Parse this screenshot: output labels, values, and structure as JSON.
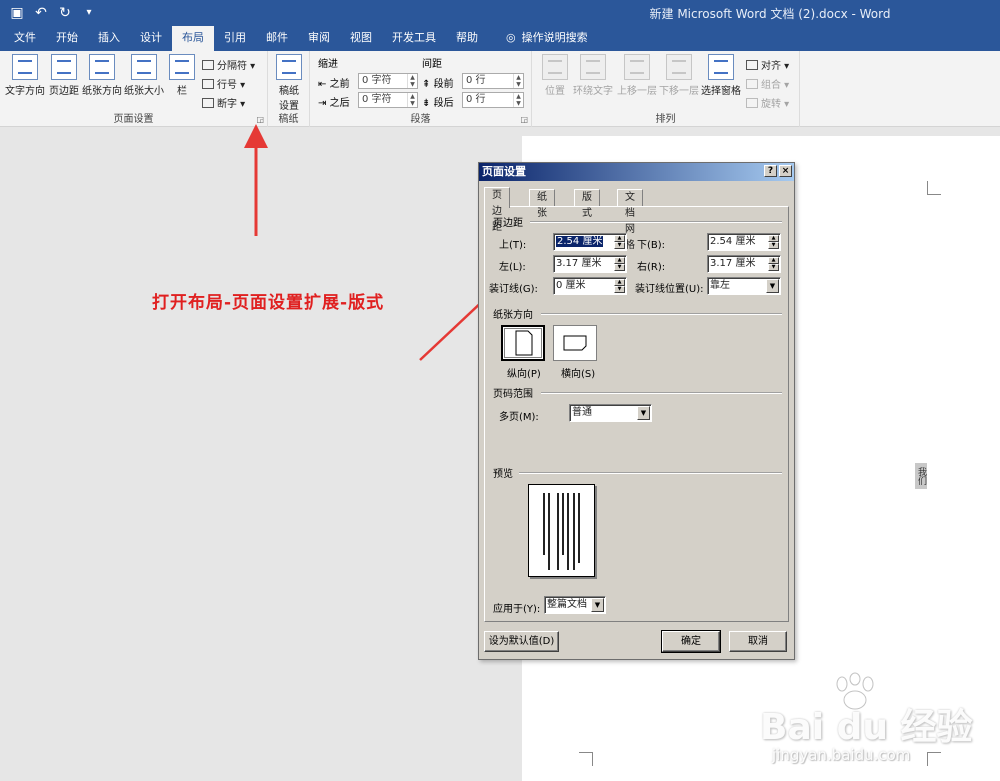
{
  "window": {
    "title": "新建 Microsoft Word 文档 (2).docx - Word"
  },
  "qat": {
    "save_icon": "save-icon",
    "undo_icon": "undo-icon",
    "redo_icon": "redo-icon",
    "customize_icon": "customize-icon"
  },
  "tabs": [
    {
      "label": "文件"
    },
    {
      "label": "开始"
    },
    {
      "label": "插入"
    },
    {
      "label": "设计"
    },
    {
      "label": "布局",
      "active": true
    },
    {
      "label": "引用"
    },
    {
      "label": "邮件"
    },
    {
      "label": "审阅"
    },
    {
      "label": "视图"
    },
    {
      "label": "开发工具"
    },
    {
      "label": "帮助"
    },
    {
      "label": "操作说明搜索"
    }
  ],
  "ribbon": {
    "page_setup": {
      "label": "页面设置",
      "text_direction": "文字方向",
      "margins": "页边距",
      "orientation": "纸张方向",
      "size": "纸张大小",
      "columns": "栏",
      "breaks": "分隔符",
      "line_numbers": "行号",
      "hyphenation": "断字"
    },
    "manuscript": {
      "label": "稿纸",
      "btn_line1": "稿纸",
      "btn_line2": "设置"
    },
    "paragraph": {
      "label": "段落",
      "indent_title": "缩进",
      "spacing_title": "间距",
      "before_label": "之前",
      "after_label": "之后",
      "indent_before": "0 字符",
      "indent_after": "0 字符",
      "sp_before_label": "段前",
      "sp_after_label": "段后",
      "spacing_before": "0 行",
      "spacing_after": "0 行"
    },
    "arrange": {
      "label": "排列",
      "position": "位置",
      "wrap": "环绕文字",
      "forward": "上移一层",
      "backward": "下移一层",
      "pane": "选择窗格",
      "align": "对齐",
      "group": "组合",
      "rotate": "旋转"
    }
  },
  "annotation": {
    "text": "打开布局-页面设置扩展-版式"
  },
  "document": {
    "vertical_text": "我们"
  },
  "dialog": {
    "title": "页面设置",
    "help_btn": "?",
    "close_btn": "×",
    "tabs": [
      "页边距",
      "纸张",
      "版式",
      "文档网格"
    ],
    "margins_section": "页边距",
    "top_label": "上(T):",
    "top_value": "2.54 厘米",
    "bottom_label": "下(B):",
    "bottom_value": "2.54 厘米",
    "left_label": "左(L):",
    "left_value": "3.17 厘米",
    "right_label": "右(R):",
    "right_value": "3.17 厘米",
    "gutter_label": "装订线(G):",
    "gutter_value": "0 厘米",
    "gutter_pos_label": "装订线位置(U):",
    "gutter_pos_value": "靠左",
    "orientation_section": "纸张方向",
    "portrait_label": "纵向(P)",
    "landscape_label": "横向(S)",
    "pages_section": "页码范围",
    "multiple_pages_label": "多页(M):",
    "multiple_pages_value": "普通",
    "preview_section": "预览",
    "apply_to_label": "应用于(Y):",
    "apply_to_value": "整篇文档",
    "set_default_btn": "设为默认值(D)",
    "ok_btn": "确定",
    "cancel_btn": "取消"
  },
  "watermark": {
    "brand": "Bai du 经验",
    "url": "jingyan.baidu.com"
  },
  "colors": {
    "word_blue": "#2b579a",
    "annotation_red": "#e02020",
    "dialog_grey": "#d4d0c8"
  }
}
